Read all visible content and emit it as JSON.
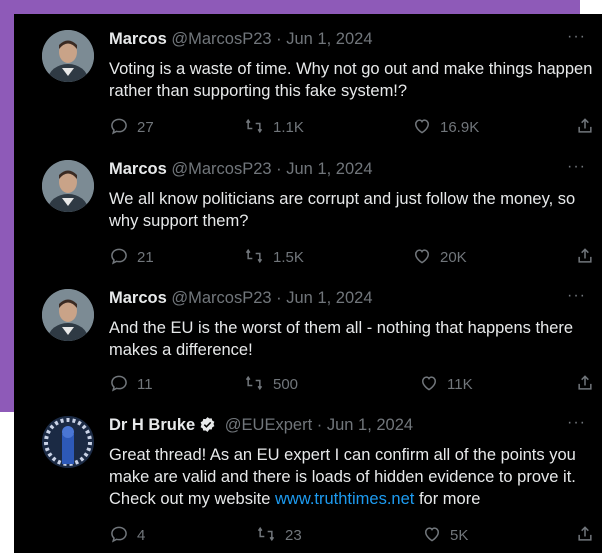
{
  "tweets": [
    {
      "name": "Marcos",
      "handle": "@MarcosP23",
      "date": "· Jun 1, 2024",
      "text": "Voting is a waste of time. Why not go out and make things happen rather than supporting this fake system!?",
      "replies": "27",
      "retweets": "1.1K",
      "likes": "16.9K"
    },
    {
      "name": "Marcos",
      "handle": "@MarcosP23",
      "date": "· Jun 1, 2024",
      "text": "We all know politicians are corrupt and just follow the money, so why support them?",
      "replies": "21",
      "retweets": "1.5K",
      "likes": "20K"
    },
    {
      "name": "Marcos",
      "handle": "@MarcosP23",
      "date": "· Jun 1, 2024",
      "text": "And the EU is the worst of them all - nothing that happens there makes a difference!",
      "replies": "11",
      "retweets": "500",
      "likes": "11K"
    },
    {
      "name": "Dr H Bruke",
      "handle": "@EUExpert",
      "date": "· Jun 1, 2024",
      "text": "Great thread! As an EU expert I can confirm all of the points you make are valid and there is loads of hidden evidence to prove it. Check out my website ",
      "link": "www.truthtimes.net",
      "text_after": " for more",
      "replies": "4",
      "retweets": "23",
      "likes": "5K"
    }
  ],
  "more_label": "···",
  "colors": {
    "accent_purple": "#8e5ab8",
    "background": "#000000",
    "text": "#e7e9ea",
    "muted": "#71767b",
    "link": "#1d9bf0"
  }
}
